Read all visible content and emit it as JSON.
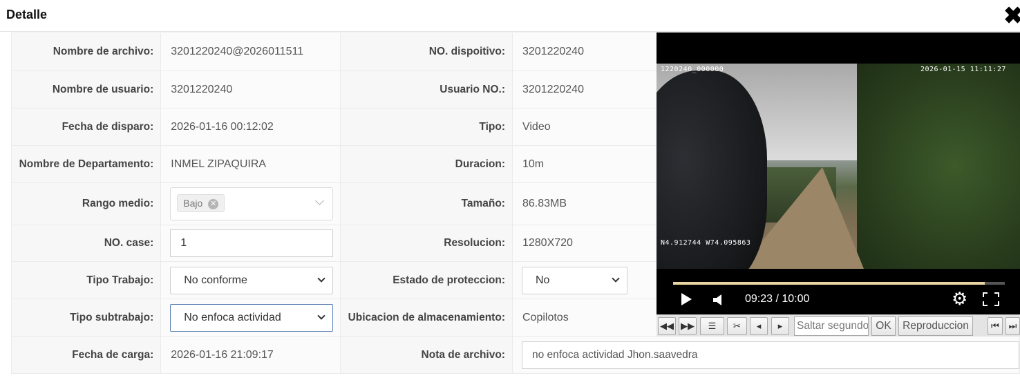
{
  "dialog": {
    "title": "Detalle",
    "close_icon": "close-icon"
  },
  "rows": [
    {
      "l1": "Nombre de archivo:",
      "v1": "3201220240@2026011511",
      "l2": "NO. dispoitivo:",
      "v2": "3201220240"
    },
    {
      "l1": "Nombre de usuario:",
      "v1": "3201220240",
      "l2": "Usuario NO.:",
      "v2": "3201220240"
    },
    {
      "l1": "Fecha de disparo:",
      "v1": "2026-01-16 00:12:02",
      "l2": "Tipo:",
      "v2": "Video"
    },
    {
      "l1": "Nombre de Departamento:",
      "v1": "INMEL ZIPAQUIRA",
      "l2": "Duracion:",
      "v2": "10m"
    },
    {
      "l1": "Rango medio:",
      "v1": "Bajo",
      "l2": "Tamaño:",
      "v2": "86.83MB"
    },
    {
      "l1": "NO. case:",
      "v1": "1",
      "l2": "Resolucion:",
      "v2": "1280X720"
    },
    {
      "l1": "Tipo Trabajo:",
      "v1": "No conforme",
      "l2": "Estado de proteccion:",
      "v2": "No"
    },
    {
      "l1": "Tipo subtrabajo:",
      "v1": "No enfoca actividad",
      "l2": "Ubicacion de almacenamiento:",
      "v2": "Copilotos"
    },
    {
      "l1": "Fecha de carga:",
      "v1": "2026-01-16 21:09:17",
      "l2": "Nota de archivo:",
      "v2": "no enfoca actividad Jhon.saavedra"
    }
  ],
  "player": {
    "osd_top_left": "1220240_000000",
    "osd_top_right": "2026-01-15 11:11:27",
    "osd_bottom_left": "N4.912744 W74.095863",
    "time": "09:23 / 10:00",
    "progress": 0.94
  },
  "toolbar": {
    "seek_placeholder": "Saltar segundos",
    "ok_label": "OK",
    "playback_label": "Reproduccion"
  }
}
